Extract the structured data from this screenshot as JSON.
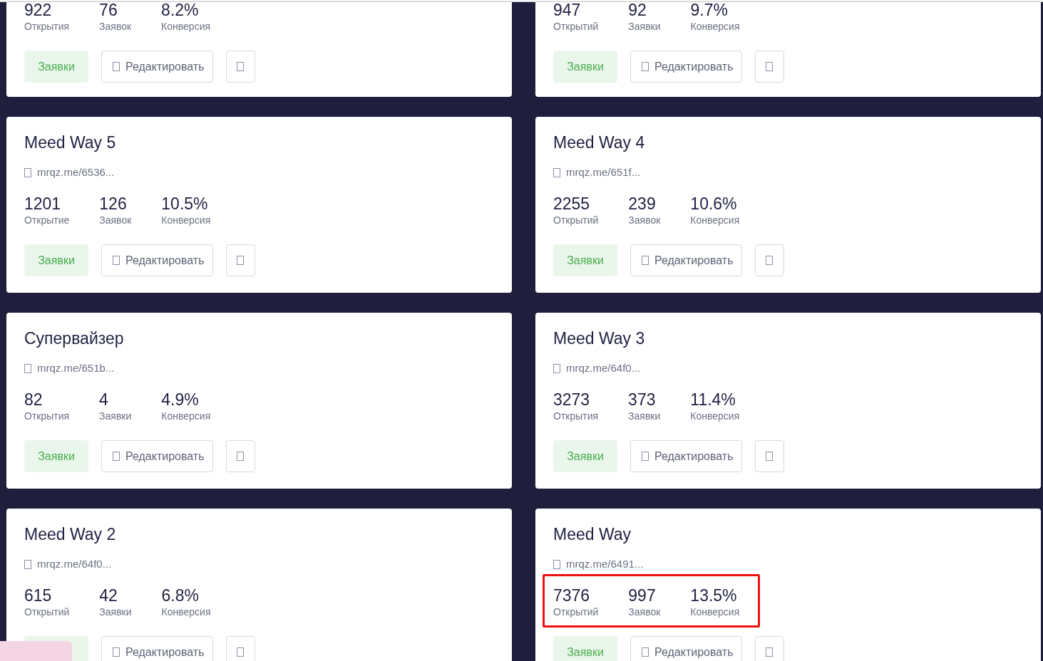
{
  "cards": [
    {
      "stats": [
        {
          "value": "922",
          "label": "Открытия"
        },
        {
          "value": "76",
          "label": "Заявок"
        },
        {
          "value": "8.2%",
          "label": "Конверсия"
        }
      ],
      "stats_highlighted": false,
      "buttons": [
        {
          "kind": "requests",
          "label": "Заявки"
        },
        {
          "kind": "edit",
          "label": "Редактировать"
        },
        {
          "kind": "more"
        }
      ]
    },
    {
      "stats": [
        {
          "value": "947",
          "label": "Открытий"
        },
        {
          "value": "92",
          "label": "Заявки"
        },
        {
          "value": "9.7%",
          "label": "Конверсия"
        }
      ],
      "stats_highlighted": false,
      "buttons": [
        {
          "kind": "requests",
          "label": "Заявки"
        },
        {
          "kind": "edit",
          "label": "Редактировать"
        },
        {
          "kind": "more"
        }
      ]
    },
    {
      "title": "Meed Way 5",
      "link": "mrqz.me/6536...",
      "stats": [
        {
          "value": "1201",
          "label": "Открытие"
        },
        {
          "value": "126",
          "label": "Заявок"
        },
        {
          "value": "10.5%",
          "label": "Конверсия"
        }
      ],
      "stats_highlighted": false,
      "buttons": [
        {
          "kind": "requests",
          "label": "Заявки"
        },
        {
          "kind": "edit",
          "label": "Редактировать"
        },
        {
          "kind": "more"
        }
      ]
    },
    {
      "title": "Meed Way 4",
      "link": "mrqz.me/651f...",
      "stats": [
        {
          "value": "2255",
          "label": "Открытий"
        },
        {
          "value": "239",
          "label": "Заявок"
        },
        {
          "value": "10.6%",
          "label": "Конверсия"
        }
      ],
      "stats_highlighted": false,
      "buttons": [
        {
          "kind": "requests",
          "label": "Заявки"
        },
        {
          "kind": "edit",
          "label": "Редактировать"
        },
        {
          "kind": "more"
        }
      ]
    },
    {
      "title": "Супервайзер",
      "link": "mrqz.me/651b...",
      "stats": [
        {
          "value": "82",
          "label": "Открытия"
        },
        {
          "value": "4",
          "label": "Заявки"
        },
        {
          "value": "4.9%",
          "label": "Конверсия"
        }
      ],
      "stats_highlighted": false,
      "buttons": [
        {
          "kind": "requests",
          "label": "Заявки"
        },
        {
          "kind": "edit",
          "label": "Редактировать"
        },
        {
          "kind": "more"
        }
      ]
    },
    {
      "title": "Meed Way 3",
      "link": "mrqz.me/64f0...",
      "stats": [
        {
          "value": "3273",
          "label": "Открытия"
        },
        {
          "value": "373",
          "label": "Заявки"
        },
        {
          "value": "11.4%",
          "label": "Конверсия"
        }
      ],
      "stats_highlighted": false,
      "buttons": [
        {
          "kind": "requests",
          "label": "Заявки"
        },
        {
          "kind": "edit",
          "label": "Редактировать"
        },
        {
          "kind": "more"
        }
      ]
    },
    {
      "title": "Meed Way 2",
      "link": "mrqz.me/64f0...",
      "stats": [
        {
          "value": "615",
          "label": "Открытий"
        },
        {
          "value": "42",
          "label": "Заявки"
        },
        {
          "value": "6.8%",
          "label": "Конверсия"
        }
      ],
      "stats_highlighted": false,
      "buttons": [
        {
          "kind": "requests"
        },
        {
          "kind": "edit",
          "label": "Редактировать"
        },
        {
          "kind": "more"
        }
      ]
    },
    {
      "title": "Meed Way",
      "link": "mrqz.me/6491...",
      "stats": [
        {
          "value": "7376",
          "label": "Открытий"
        },
        {
          "value": "997",
          "label": "Заявок"
        },
        {
          "value": "13.5%",
          "label": "Конверсия"
        }
      ],
      "stats_highlighted": true,
      "buttons": [
        {
          "kind": "requests",
          "label": "Заявки"
        },
        {
          "kind": "edit",
          "label": "Редактировать"
        },
        {
          "kind": "more"
        }
      ]
    }
  ]
}
